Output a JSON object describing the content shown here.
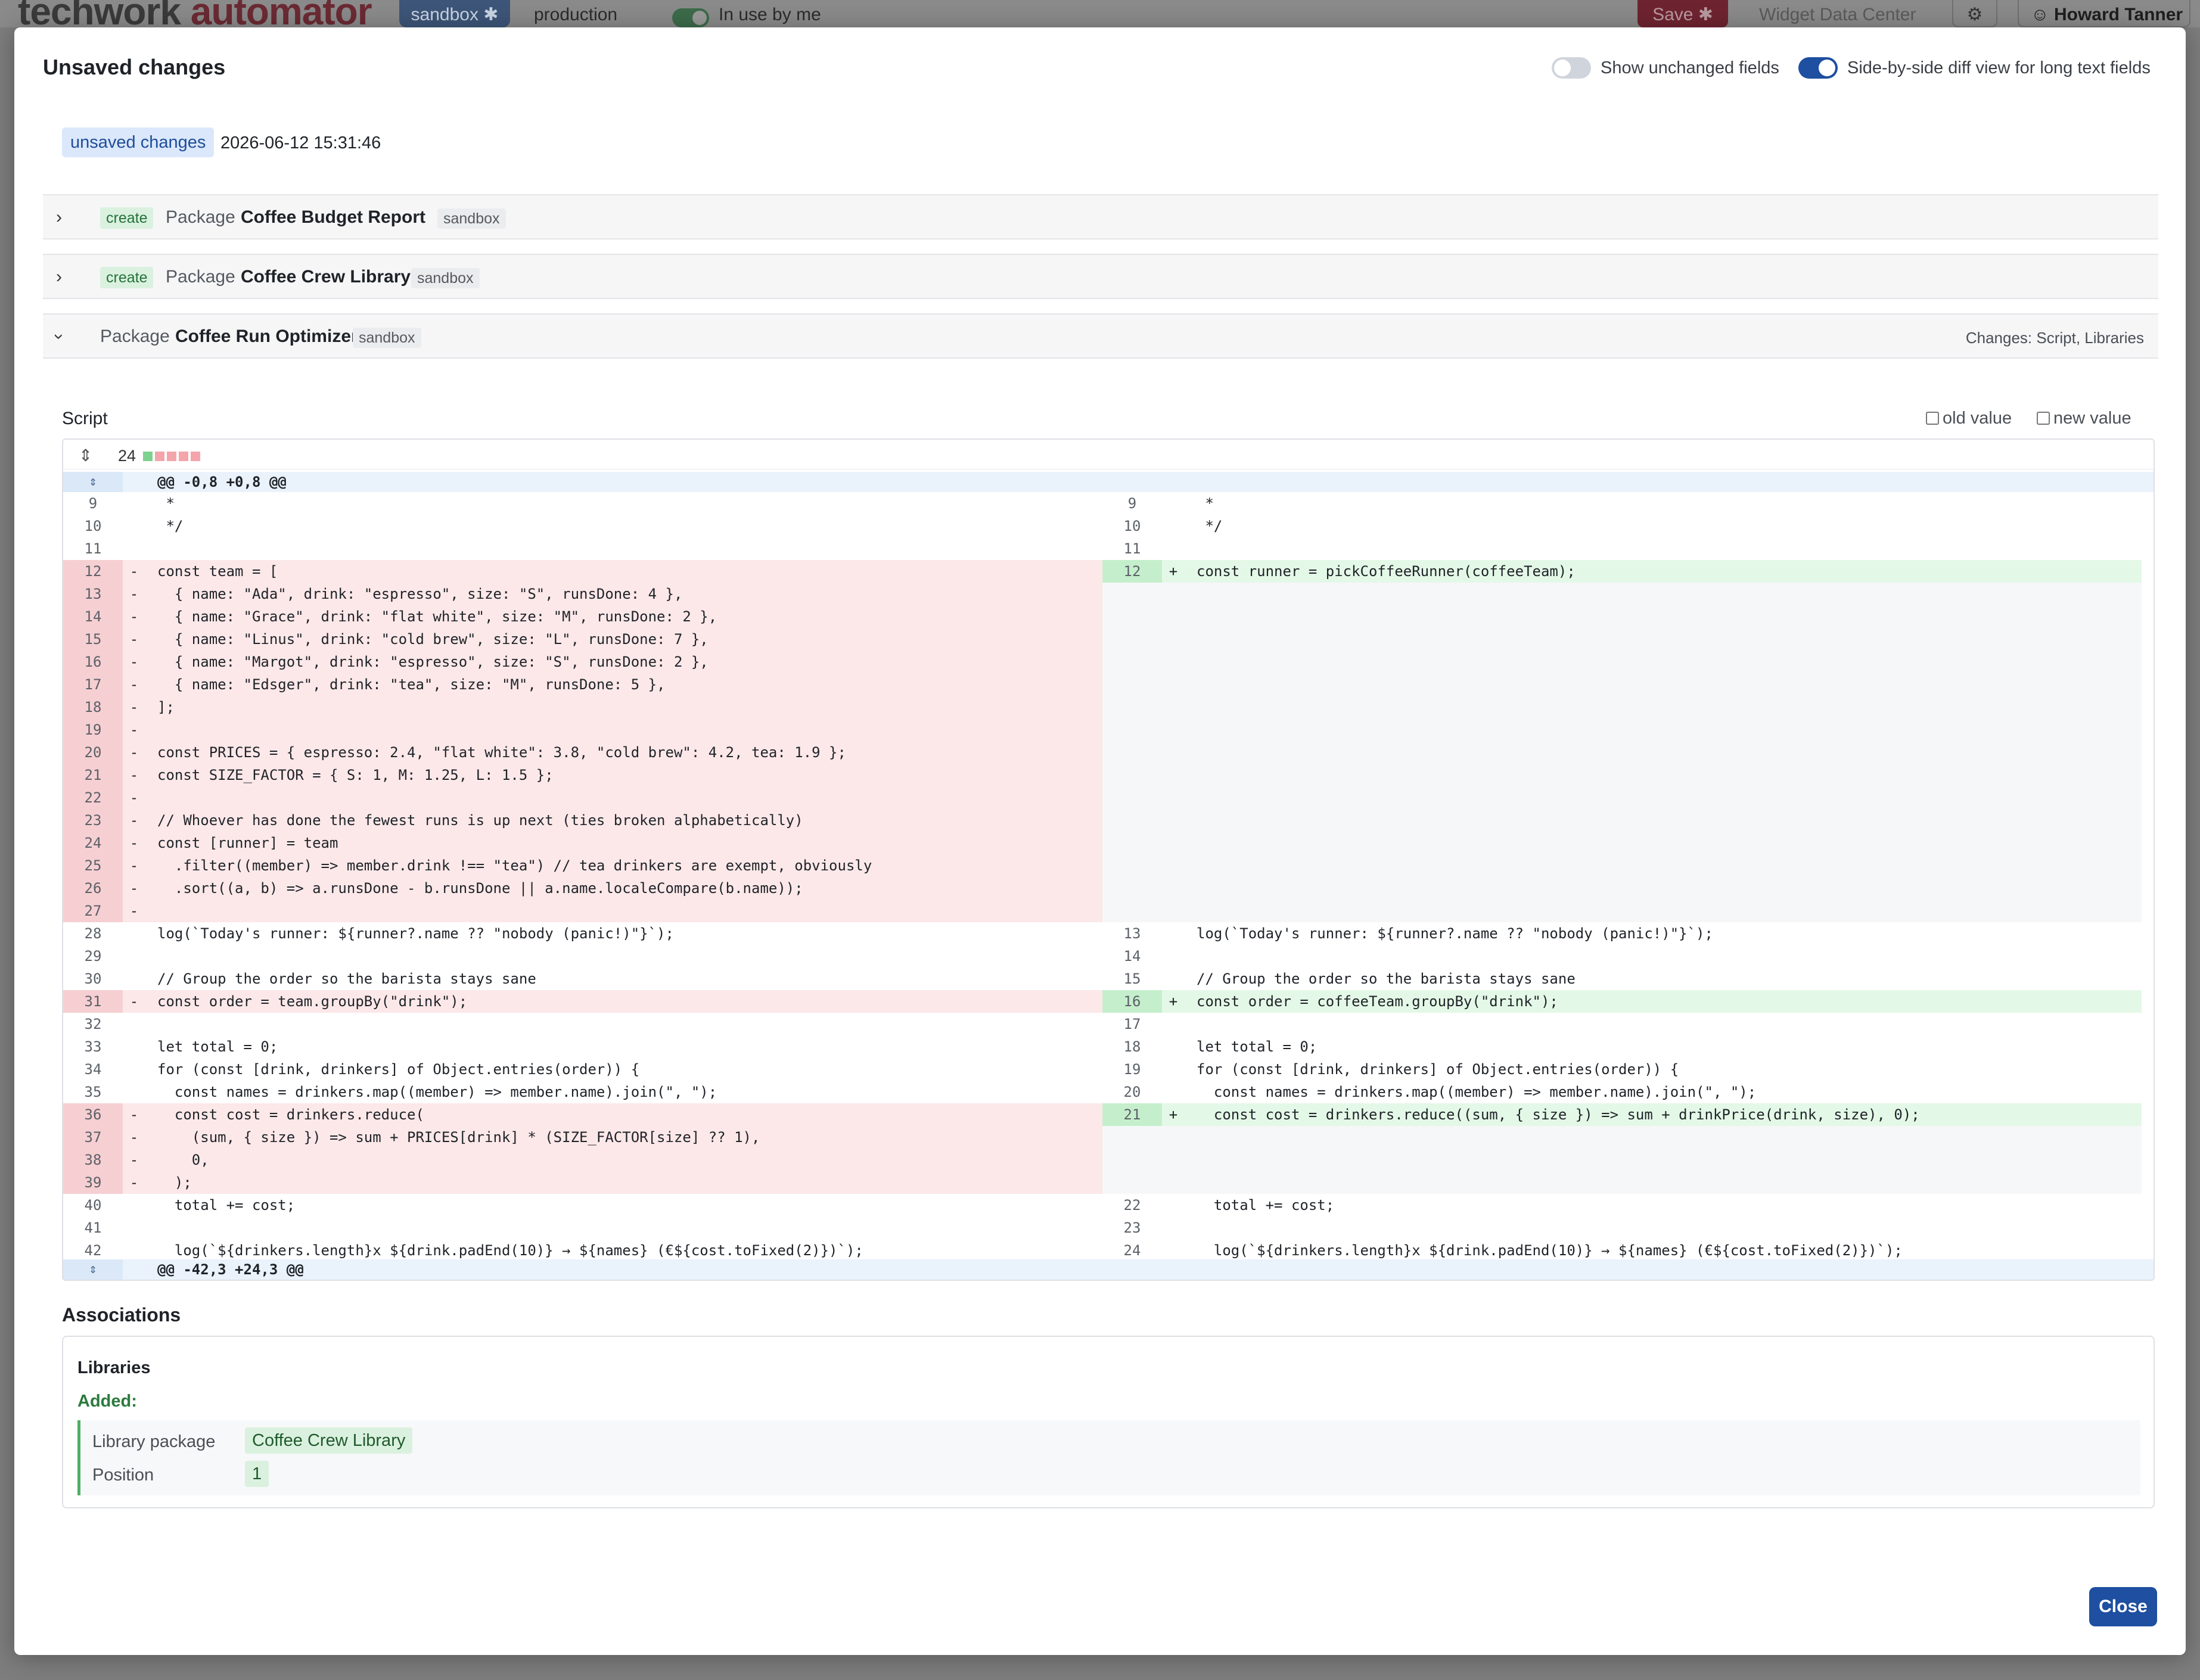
{
  "app": {
    "logo_main": "techwork",
    "logo_accent": " automator",
    "env_sandbox": "sandbox ✱",
    "env_production": "production",
    "in_use_label": "In use by me",
    "save_label": "Save ✱",
    "widget_data_center": "Widget Data Center",
    "user_name": "Howard Tanner"
  },
  "modal": {
    "title": "Unsaved changes",
    "show_unchanged_label": "Show unchanged fields",
    "show_unchanged_on": false,
    "side_by_side_label": "Side-by-side diff view for long text fields",
    "side_by_side_on": true,
    "status_badge": "unsaved changes",
    "timestamp": "2026-06-12 15:31:46",
    "close_label": "Close"
  },
  "packages": [
    {
      "op": "create",
      "kind": "Package",
      "name": "Coffee Budget Report",
      "env": "sandbox",
      "expanded": false
    },
    {
      "op": "create",
      "kind": "Package",
      "name": "Coffee Crew Library",
      "env": "sandbox",
      "expanded": false
    },
    {
      "op": "",
      "kind": "Package",
      "name": "Coffee Run Optimizer",
      "env": "sandbox",
      "expanded": true,
      "changes": "Changes: Script, Libraries"
    }
  ],
  "script": {
    "label": "Script",
    "old_value_label": "old value",
    "new_value_label": "new value",
    "change_count": "24",
    "hunk_top": "@@ -0,8 +0,8 @@",
    "hunk_bottom": "@@ -42,3 +24,3 @@",
    "rows": [
      {
        "ln": "9",
        "lt": " *",
        "lk": "ctx",
        "rn": "9",
        "rt": " *",
        "rk": "ctx"
      },
      {
        "ln": "10",
        "lt": " */",
        "lk": "ctx",
        "rn": "10",
        "rt": " */",
        "rk": "ctx"
      },
      {
        "ln": "11",
        "lt": "",
        "lk": "ctx",
        "rn": "11",
        "rt": "",
        "rk": "ctx"
      },
      {
        "ln": "12",
        "lt": "const team = [",
        "lk": "del",
        "rn": "12",
        "rt": "const runner = pickCoffeeRunner(coffeeTeam);",
        "rk": "add"
      },
      {
        "ln": "13",
        "lt": "  { name: \"Ada\", drink: \"espresso\", size: \"S\", runsDone: 4 },",
        "lk": "del",
        "rn": "",
        "rt": "",
        "rk": "empty"
      },
      {
        "ln": "14",
        "lt": "  { name: \"Grace\", drink: \"flat white\", size: \"M\", runsDone: 2 },",
        "lk": "del",
        "rn": "",
        "rt": "",
        "rk": "empty"
      },
      {
        "ln": "15",
        "lt": "  { name: \"Linus\", drink: \"cold brew\", size: \"L\", runsDone: 7 },",
        "lk": "del",
        "rn": "",
        "rt": "",
        "rk": "empty"
      },
      {
        "ln": "16",
        "lt": "  { name: \"Margot\", drink: \"espresso\", size: \"S\", runsDone: 2 },",
        "lk": "del",
        "rn": "",
        "rt": "",
        "rk": "empty"
      },
      {
        "ln": "17",
        "lt": "  { name: \"Edsger\", drink: \"tea\", size: \"M\", runsDone: 5 },",
        "lk": "del",
        "rn": "",
        "rt": "",
        "rk": "empty"
      },
      {
        "ln": "18",
        "lt": "];",
        "lk": "del",
        "rn": "",
        "rt": "",
        "rk": "empty"
      },
      {
        "ln": "19",
        "lt": "",
        "lk": "del",
        "rn": "",
        "rt": "",
        "rk": "empty"
      },
      {
        "ln": "20",
        "lt": "const PRICES = { espresso: 2.4, \"flat white\": 3.8, \"cold brew\": 4.2, tea: 1.9 };",
        "lk": "del",
        "rn": "",
        "rt": "",
        "rk": "empty"
      },
      {
        "ln": "21",
        "lt": "const SIZE_FACTOR = { S: 1, M: 1.25, L: 1.5 };",
        "lk": "del",
        "rn": "",
        "rt": "",
        "rk": "empty"
      },
      {
        "ln": "22",
        "lt": "",
        "lk": "del",
        "rn": "",
        "rt": "",
        "rk": "empty"
      },
      {
        "ln": "23",
        "lt": "// Whoever has done the fewest runs is up next (ties broken alphabetically)",
        "lk": "del",
        "rn": "",
        "rt": "",
        "rk": "empty"
      },
      {
        "ln": "24",
        "lt": "const [runner] = team",
        "lk": "del",
        "rn": "",
        "rt": "",
        "rk": "empty"
      },
      {
        "ln": "25",
        "lt": "  .filter((member) => member.drink !== \"tea\") // tea drinkers are exempt, obviously",
        "lk": "del",
        "rn": "",
        "rt": "",
        "rk": "empty"
      },
      {
        "ln": "26",
        "lt": "  .sort((a, b) => a.runsDone - b.runsDone || a.name.localeCompare(b.name));",
        "lk": "del",
        "rn": "",
        "rt": "",
        "rk": "empty"
      },
      {
        "ln": "27",
        "lt": "",
        "lk": "del",
        "rn": "",
        "rt": "",
        "rk": "empty"
      },
      {
        "ln": "28",
        "lt": "log(`Today's runner: ${runner?.name ?? \"nobody (panic!)\"}`);",
        "lk": "ctx",
        "rn": "13",
        "rt": "log(`Today's runner: ${runner?.name ?? \"nobody (panic!)\"}`);",
        "rk": "ctx"
      },
      {
        "ln": "29",
        "lt": "",
        "lk": "ctx",
        "rn": "14",
        "rt": "",
        "rk": "ctx"
      },
      {
        "ln": "30",
        "lt": "// Group the order so the barista stays sane",
        "lk": "ctx",
        "rn": "15",
        "rt": "// Group the order so the barista stays sane",
        "rk": "ctx"
      },
      {
        "ln": "31",
        "lt": "const order = team.groupBy(\"drink\");",
        "lk": "del",
        "rn": "16",
        "rt": "const order = coffeeTeam.groupBy(\"drink\");",
        "rk": "add"
      },
      {
        "ln": "32",
        "lt": "",
        "lk": "ctx",
        "rn": "17",
        "rt": "",
        "rk": "ctx"
      },
      {
        "ln": "33",
        "lt": "let total = 0;",
        "lk": "ctx",
        "rn": "18",
        "rt": "let total = 0;",
        "rk": "ctx"
      },
      {
        "ln": "34",
        "lt": "for (const [drink, drinkers] of Object.entries(order)) {",
        "lk": "ctx",
        "rn": "19",
        "rt": "for (const [drink, drinkers] of Object.entries(order)) {",
        "rk": "ctx"
      },
      {
        "ln": "35",
        "lt": "  const names = drinkers.map((member) => member.name).join(\", \");",
        "lk": "ctx",
        "rn": "20",
        "rt": "  const names = drinkers.map((member) => member.name).join(\", \");",
        "rk": "ctx"
      },
      {
        "ln": "36",
        "lt": "  const cost = drinkers.reduce(",
        "lk": "del",
        "rn": "21",
        "rt": "  const cost = drinkers.reduce((sum, { size }) => sum + drinkPrice(drink, size), 0);",
        "rk": "add"
      },
      {
        "ln": "37",
        "lt": "    (sum, { size }) => sum + PRICES[drink] * (SIZE_FACTOR[size] ?? 1),",
        "lk": "del",
        "rn": "",
        "rt": "",
        "rk": "empty"
      },
      {
        "ln": "38",
        "lt": "    0,",
        "lk": "del",
        "rn": "",
        "rt": "",
        "rk": "empty"
      },
      {
        "ln": "39",
        "lt": "  );",
        "lk": "del",
        "rn": "",
        "rt": "",
        "rk": "empty"
      },
      {
        "ln": "40",
        "lt": "  total += cost;",
        "lk": "ctx",
        "rn": "22",
        "rt": "  total += cost;",
        "rk": "ctx"
      },
      {
        "ln": "41",
        "lt": "",
        "lk": "ctx",
        "rn": "23",
        "rt": "",
        "rk": "ctx"
      },
      {
        "ln": "42",
        "lt": "  log(`${drinkers.length}x ${drink.padEnd(10)} → ${names} (€${cost.toFixed(2)})`);",
        "lk": "ctx",
        "rn": "24",
        "rt": "  log(`${drinkers.length}x ${drink.padEnd(10)} → ${names} (€${cost.toFixed(2)})`);",
        "rk": "ctx"
      }
    ]
  },
  "associations": {
    "title": "Associations",
    "group_title": "Libraries",
    "added_label": "Added:",
    "fields": [
      {
        "label": "Library package",
        "value": "Coffee Crew Library"
      },
      {
        "label": "Position",
        "value": "1"
      }
    ]
  },
  "colors": {
    "accent": "#1e4fa0",
    "deleted_bg": "#fce8e9",
    "deleted_gutter": "#f6cfd2",
    "added_bg": "#e4f8e7",
    "added_gutter": "#c5efcc",
    "empty_bg": "#f6f7f8"
  }
}
